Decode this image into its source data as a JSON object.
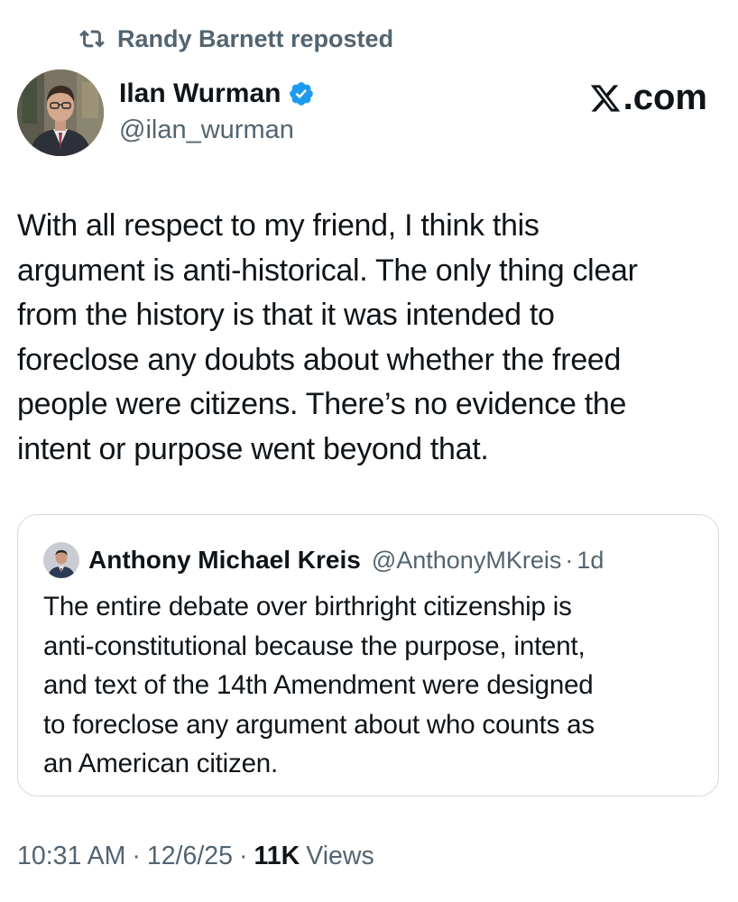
{
  "repost": {
    "icon": "repost-icon",
    "text": "Randy Barnett reposted"
  },
  "author": {
    "name": "Ilan Wurman",
    "handle": "@ilan_wurman",
    "verified_icon": "verified-badge-icon",
    "verified_color": "#1d9bf0"
  },
  "site": {
    "logo_icon": "x-logo-icon",
    "suffix": ".com"
  },
  "tweet": {
    "lines": [
      "With all respect to my friend, I think this",
      "argument is anti-historical. The only thing clear",
      "from the history is that it was intended to",
      "foreclose any doubts about whether the freed",
      "people were citizens. There’s no evidence the",
      "intent or purpose went beyond that."
    ]
  },
  "quote": {
    "name": "Anthony Michael Kreis",
    "handle": "@AnthonyMKreis",
    "separator": "·",
    "time": "1d",
    "lines": [
      "The entire debate over birthright citizenship is",
      "anti-constitutional because the purpose, intent,",
      "and text of the 14th Amendment were designed",
      "to foreclose any argument about who counts as",
      "an American citizen."
    ]
  },
  "meta": {
    "time": "10:31 AM",
    "separator": "·",
    "date": "12/6/25",
    "views_count": "11K",
    "views_label": "Views"
  },
  "colors": {
    "text_primary": "#0f1419",
    "text_secondary": "#536471",
    "border": "#cfd9de",
    "verified": "#1d9bf0"
  }
}
